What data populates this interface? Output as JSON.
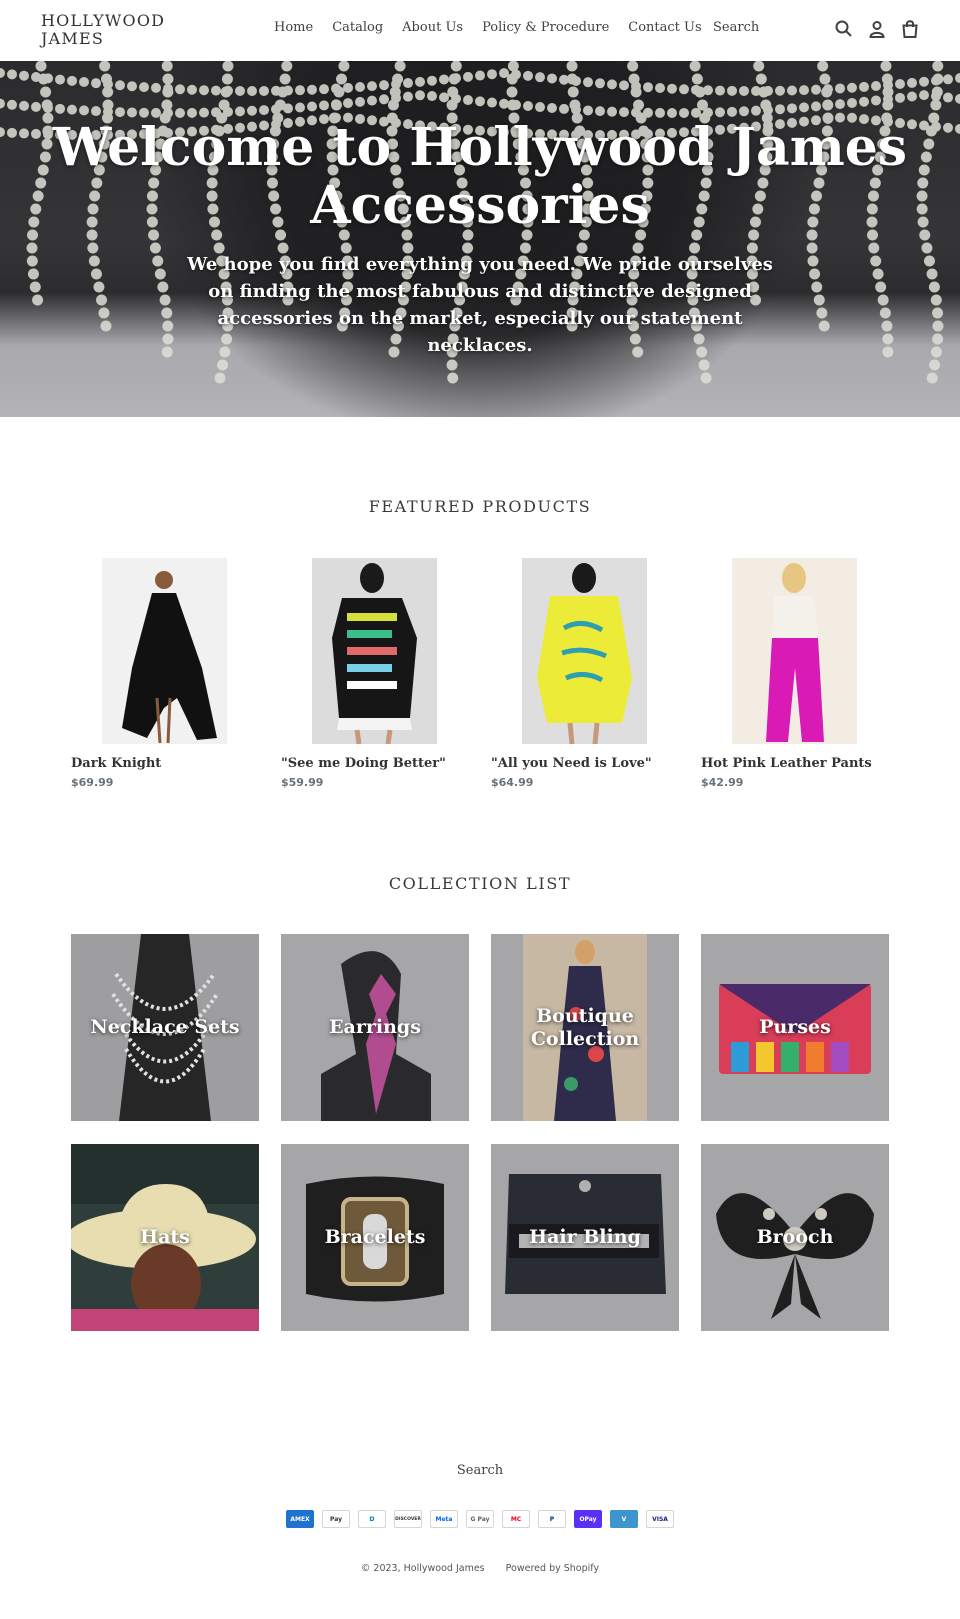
{
  "header": {
    "logo_line1": "HOLLYWOOD",
    "logo_line2": "JAMES",
    "nav": [
      "Home",
      "Catalog",
      "About Us",
      "Policy & Procedure",
      "Contact Us"
    ],
    "search_label": "Search"
  },
  "hero": {
    "title": "Welcome to Hollywood James Accessories",
    "subtitle": "We hope you find everything you need. We pride ourselves on finding the most fabulous and distinctive designed accessories on the market, especially our statement necklaces."
  },
  "featured": {
    "title": "FEATURED PRODUCTS",
    "products": [
      {
        "name": "Dark Knight",
        "price": "$69.99"
      },
      {
        "name": "\"See me Doing Better\"",
        "price": "$59.99"
      },
      {
        "name": "\"All you Need is Love\"",
        "price": "$64.99"
      },
      {
        "name": "Hot Pink Leather Pants",
        "price": "$42.99"
      }
    ]
  },
  "collections": {
    "title": "COLLECTION LIST",
    "items": [
      {
        "label": "Necklace Sets"
      },
      {
        "label": "Earrings"
      },
      {
        "label": "Boutique Collection"
      },
      {
        "label": "Purses"
      },
      {
        "label": "Hats"
      },
      {
        "label": "Bracelets"
      },
      {
        "label": "Hair Bling"
      },
      {
        "label": "Brooch"
      }
    ]
  },
  "footer": {
    "search_label": "Search",
    "payments": [
      "AMEX",
      "Pay",
      "D",
      "DISCOVER",
      "Meta",
      "G Pay",
      "MC",
      "P",
      "OPay",
      "V",
      "VISA"
    ],
    "copyright": "© 2023, Hollywood James",
    "powered": "Powered by Shopify"
  },
  "colors": {
    "accent_text": "#3a3a3a",
    "price_text": "#69727b"
  }
}
